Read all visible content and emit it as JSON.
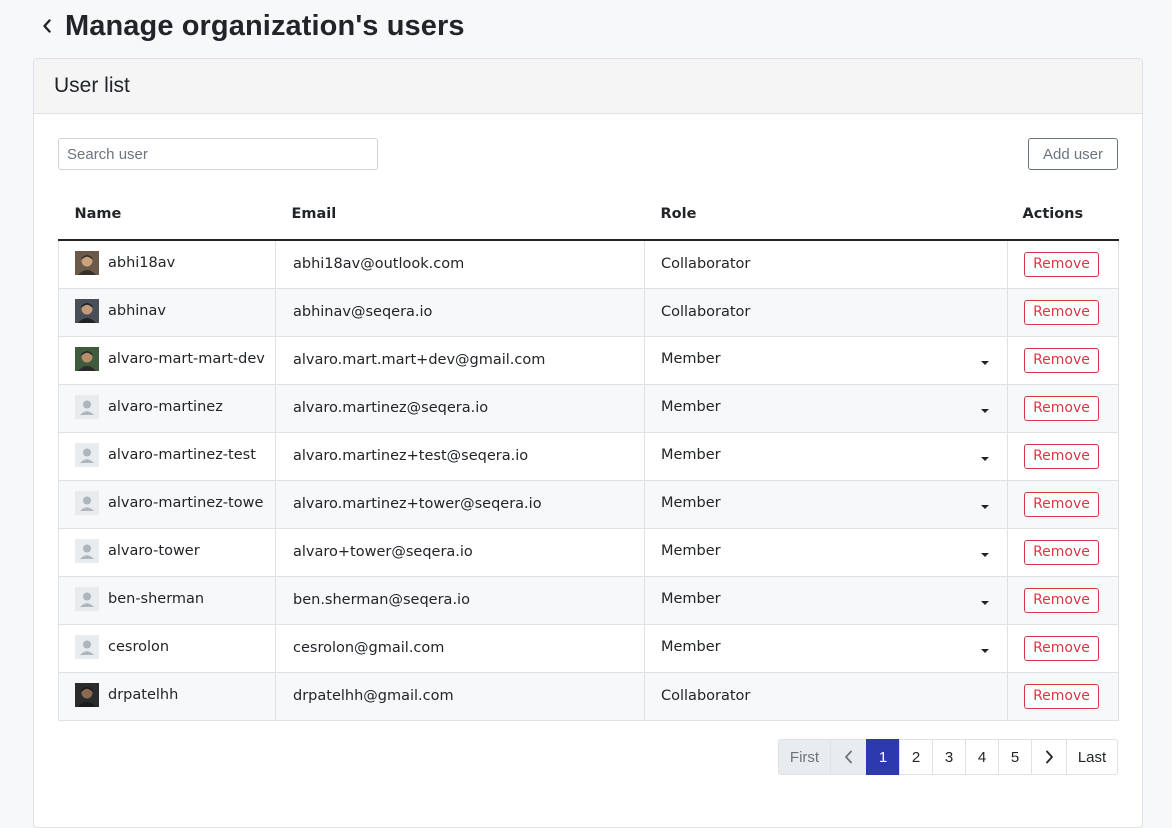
{
  "header": {
    "back_icon": "chevron-left-icon",
    "title": "Manage organization's users"
  },
  "card": {
    "title": "User list"
  },
  "search": {
    "placeholder": "Search user",
    "value": ""
  },
  "toolbar": {
    "add_user_label": "Add user"
  },
  "table": {
    "columns": [
      "Name",
      "Email",
      "Role",
      "Actions"
    ],
    "rows": [
      {
        "name": "abhi18av",
        "email": "abhi18av@outlook.com",
        "role": "Collaborator",
        "role_dropdown": false,
        "avatar": "photo",
        "action": "Remove"
      },
      {
        "name": "abhinav",
        "email": "abhinav@seqera.io",
        "role": "Collaborator",
        "role_dropdown": false,
        "avatar": "photo",
        "action": "Remove"
      },
      {
        "name": "alvaro-mart-mart-dev",
        "email": "alvaro.mart.mart+dev@gmail.com",
        "role": "Member",
        "role_dropdown": true,
        "avatar": "photo",
        "action": "Remove"
      },
      {
        "name": "alvaro-martinez",
        "email": "alvaro.martinez@seqera.io",
        "role": "Member",
        "role_dropdown": true,
        "avatar": "default",
        "action": "Remove"
      },
      {
        "name": "alvaro-martinez-test",
        "email": "alvaro.martinez+test@seqera.io",
        "role": "Member",
        "role_dropdown": true,
        "avatar": "default",
        "action": "Remove"
      },
      {
        "name": "alvaro-martinez-towe",
        "email": "alvaro.martinez+tower@seqera.io",
        "role": "Member",
        "role_dropdown": true,
        "avatar": "default",
        "action": "Remove"
      },
      {
        "name": "alvaro-tower",
        "email": "alvaro+tower@seqera.io",
        "role": "Member",
        "role_dropdown": true,
        "avatar": "default",
        "action": "Remove"
      },
      {
        "name": "ben-sherman",
        "email": "ben.sherman@seqera.io",
        "role": "Member",
        "role_dropdown": true,
        "avatar": "default",
        "action": "Remove"
      },
      {
        "name": "cesrolon",
        "email": "cesrolon@gmail.com",
        "role": "Member",
        "role_dropdown": true,
        "avatar": "default",
        "action": "Remove"
      },
      {
        "name": "drpatelhh",
        "email": "drpatelhh@gmail.com",
        "role": "Collaborator",
        "role_dropdown": false,
        "avatar": "photo",
        "action": "Remove"
      }
    ]
  },
  "pagination": {
    "first_label": "First",
    "prev_icon": "chevron-left-icon",
    "pages": [
      "1",
      "2",
      "3",
      "4",
      "5"
    ],
    "current_page": "1",
    "next_icon": "chevron-right-icon",
    "last_label": "Last"
  },
  "colors": {
    "danger": "#dc3545",
    "active_page": "#2d3aad",
    "header_bg": "#f5f5f6"
  }
}
